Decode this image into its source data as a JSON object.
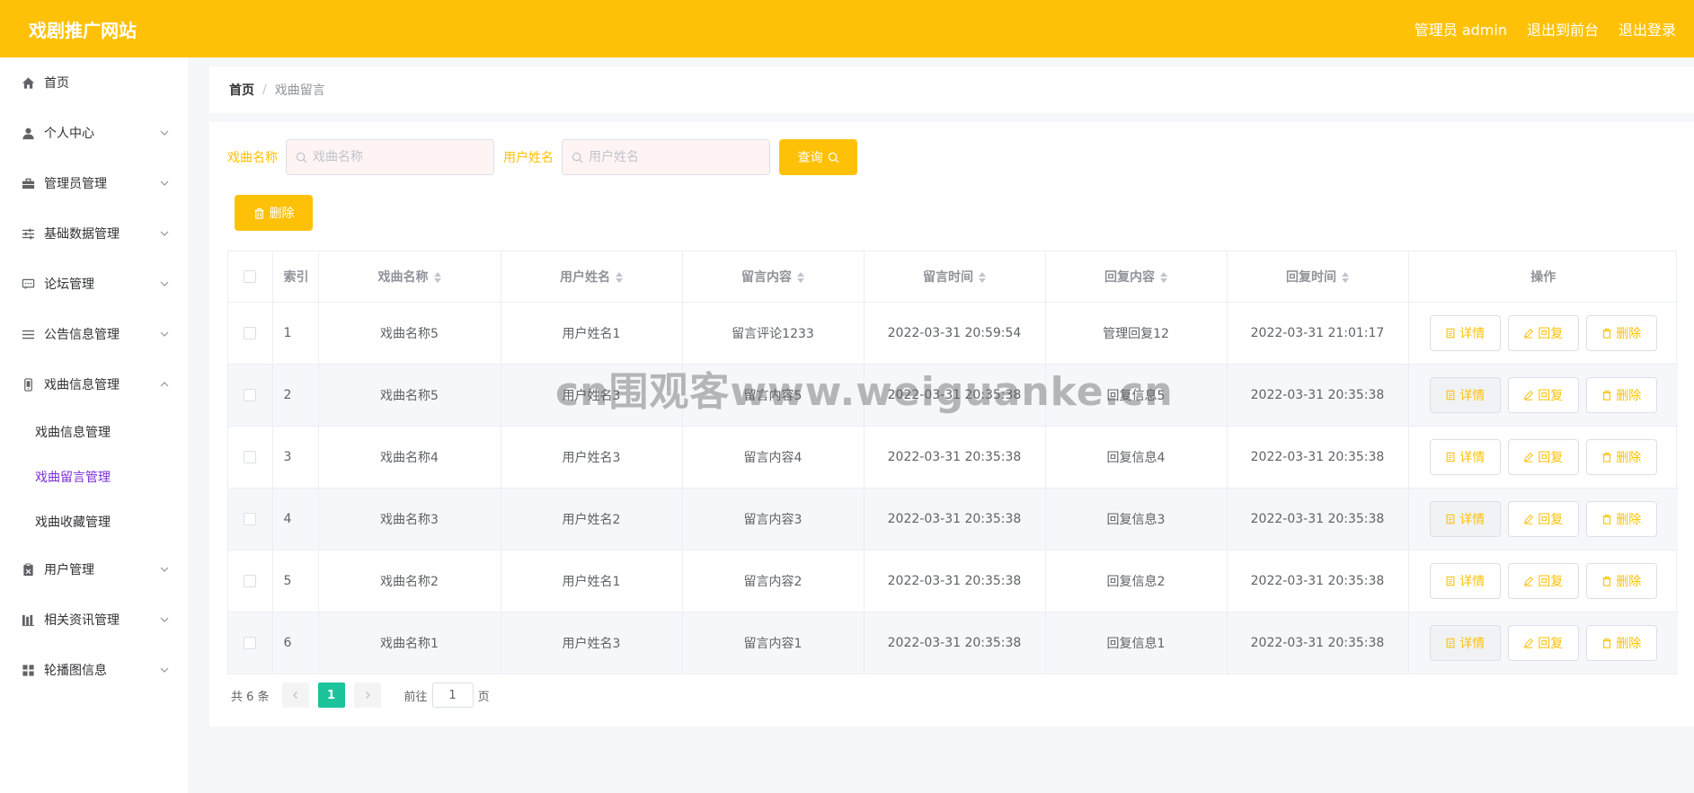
{
  "header": {
    "title": "戏剧推广网站",
    "admin_label": "管理员 admin",
    "back_front": "退出到前台",
    "logout": "退出登录"
  },
  "sidebar": {
    "items": [
      {
        "label": "首页",
        "icon": "home-icon",
        "has_arrow": false
      },
      {
        "label": "个人中心",
        "icon": "user-icon",
        "has_arrow": true
      },
      {
        "label": "管理员管理",
        "icon": "briefcase-icon",
        "has_arrow": true
      },
      {
        "label": "基础数据管理",
        "icon": "sliders-icon",
        "has_arrow": true
      },
      {
        "label": "论坛管理",
        "icon": "chat-icon",
        "has_arrow": true
      },
      {
        "label": "公告信息管理",
        "icon": "list-icon",
        "has_arrow": true
      },
      {
        "label": "戏曲信息管理",
        "icon": "mobile-icon",
        "has_arrow": true,
        "expanded": true
      },
      {
        "label": "用户管理",
        "icon": "clipboard-icon",
        "has_arrow": true
      },
      {
        "label": "相关资讯管理",
        "icon": "chart-bar-icon",
        "has_arrow": true
      },
      {
        "label": "轮播图信息",
        "icon": "grid-icon",
        "has_arrow": true
      }
    ],
    "submenu": [
      {
        "label": "戏曲信息管理",
        "active": false
      },
      {
        "label": "戏曲留言管理",
        "active": true
      },
      {
        "label": "戏曲收藏管理",
        "active": false
      }
    ]
  },
  "breadcrumb": {
    "home": "首页",
    "separator": "/",
    "current": "戏曲留言"
  },
  "search": {
    "opera_label": "戏曲名称",
    "opera_placeholder": "戏曲名称",
    "user_label": "用户姓名",
    "user_placeholder": "用户姓名",
    "query_button": "查询"
  },
  "toolbar": {
    "delete_button": "删除"
  },
  "table": {
    "headers": [
      "索引",
      "戏曲名称",
      "用户姓名",
      "留言内容",
      "留言时间",
      "回复内容",
      "回复时间",
      "操作"
    ],
    "rows": [
      [
        "1",
        "戏曲名称5",
        "用户姓名1",
        "留言评论1233",
        "2022-03-31 20:59:54",
        "管理回复12",
        "2022-03-31 21:01:17"
      ],
      [
        "2",
        "戏曲名称5",
        "用户姓名3",
        "留言内容5",
        "2022-03-31 20:35:38",
        "回复信息5",
        "2022-03-31 20:35:38"
      ],
      [
        "3",
        "戏曲名称4",
        "用户姓名3",
        "留言内容4",
        "2022-03-31 20:35:38",
        "回复信息4",
        "2022-03-31 20:35:38"
      ],
      [
        "4",
        "戏曲名称3",
        "用户姓名2",
        "留言内容3",
        "2022-03-31 20:35:38",
        "回复信息3",
        "2022-03-31 20:35:38"
      ],
      [
        "5",
        "戏曲名称2",
        "用户姓名1",
        "留言内容2",
        "2022-03-31 20:35:38",
        "回复信息2",
        "2022-03-31 20:35:38"
      ],
      [
        "6",
        "戏曲名称1",
        "用户姓名3",
        "留言内容1",
        "2022-03-31 20:35:38",
        "回复信息1",
        "2022-03-31 20:35:38"
      ]
    ],
    "actions": {
      "detail": "详情",
      "reply": "回复",
      "delete": "删除"
    }
  },
  "pagination": {
    "total": "共 6 条",
    "current_page": "1",
    "goto_label": "前往",
    "goto_value": "1",
    "page_suffix": "页"
  },
  "watermark": "cn围观客www.weiguanke.cn",
  "colors": {
    "accent": "#ffc107",
    "active_menu": "#7b2ed6",
    "pagination_active": "#1bc49b"
  }
}
